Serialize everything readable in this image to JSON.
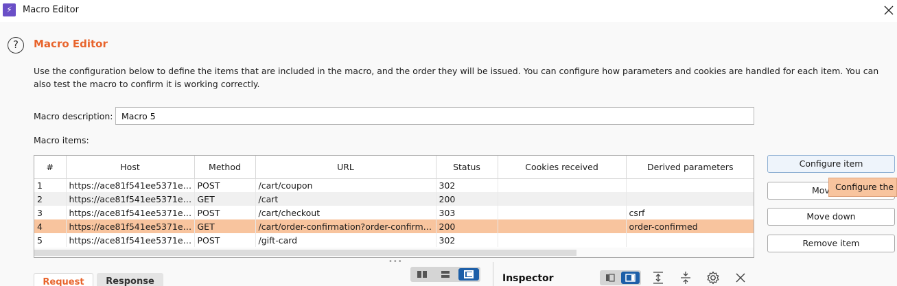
{
  "window": {
    "title": "Macro Editor",
    "app_icon": "lightning-icon"
  },
  "heading": "Macro Editor",
  "description": "Use the configuration below to define the items that are included in the macro, and the order they will be issued. You can configure how parameters and cookies are handled for each item. You can also test the macro to confirm it is working correctly.",
  "macro_description": {
    "label": "Macro description:",
    "value": "Macro 5"
  },
  "macro_items_label": "Macro items:",
  "table": {
    "columns": [
      "#",
      "Host",
      "Method",
      "URL",
      "Status",
      "Cookies received",
      "Derived parameters"
    ],
    "rows": [
      {
        "num": "1",
        "host": "https://ace81f541ee5371ec…",
        "method": "POST",
        "url": "/cart/coupon",
        "status": "302",
        "cookies": "",
        "derived": ""
      },
      {
        "num": "2",
        "host": "https://ace81f541ee5371ec…",
        "method": "GET",
        "url": "/cart",
        "status": "200",
        "cookies": "",
        "derived": ""
      },
      {
        "num": "3",
        "host": "https://ace81f541ee5371ec…",
        "method": "POST",
        "url": "/cart/checkout",
        "status": "303",
        "cookies": "",
        "derived": "csrf"
      },
      {
        "num": "4",
        "host": "https://ace81f541ee5371ec…",
        "method": "GET",
        "url": "/cart/order-confirmation?order-confirme…",
        "status": "200",
        "cookies": "",
        "derived": "order-confirmed"
      },
      {
        "num": "5",
        "host": "https://ace81f541ee5371ec…",
        "method": "POST",
        "url": "/gift-card",
        "status": "302",
        "cookies": "",
        "derived": ""
      }
    ],
    "selected_row": 4
  },
  "buttons": {
    "configure_item": "Configure item",
    "move_up": "Mov",
    "move_down": "Move down",
    "remove_item": "Remove item"
  },
  "tooltip": "Configure the s",
  "tabs": {
    "request": "Request",
    "response": "Response"
  },
  "inspector": {
    "title": "Inspector"
  },
  "colors": {
    "accent": "#e8642c",
    "selection": "#f8c49e",
    "active_toggle": "#1d5fa8"
  }
}
